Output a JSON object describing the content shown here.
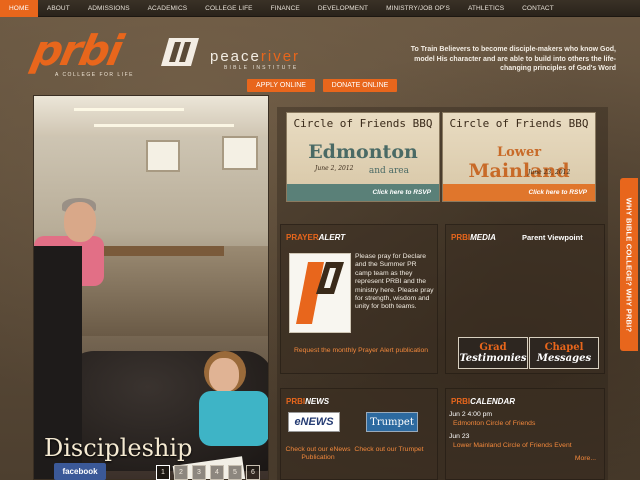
{
  "nav": {
    "items": [
      "HOME",
      "ABOUT",
      "ADMISSIONS",
      "ACADEMICS",
      "COLLEGE LIFE",
      "FINANCE",
      "DEVELOPMENT",
      "MINISTRY/JOB OP'S",
      "ATHLETICS",
      "CONTACT"
    ],
    "active": "HOME"
  },
  "brand": {
    "logo_text": "prbi",
    "tagline": "A COLLEGE FOR LIFE",
    "institute_peace": "peace",
    "institute_river": "river",
    "institute_sub": "BIBLE INSTITUTE",
    "accent_color": "#e8661c"
  },
  "mission": "To Train Believers to become disciple-makers who know God, model His character and are able to build into others the life-changing principles of God's Word",
  "buttons": {
    "apply": "APPLY ONLINE",
    "donate": "DONATE ONLINE"
  },
  "hero": {
    "caption": "Discipleship",
    "facebook": "facebook",
    "pages": [
      "1",
      "2",
      "3",
      "4",
      "5",
      "6"
    ],
    "active_page": "1"
  },
  "events": [
    {
      "title": "Circle of Friends BBQ",
      "place": "Edmonton",
      "place_sub": "and area",
      "date": "June 2, 2012",
      "rsvp": "Click here to RSVP"
    },
    {
      "title": "Circle of Friends BBQ",
      "place_pre": "Lower",
      "place": "Mainland",
      "date": "June 23, 2012",
      "rsvp": "Click here to RSVP"
    }
  ],
  "prayer": {
    "heading_pre": "PRAYER",
    "heading": "ALERT",
    "text": "Please pray for Declare and the Summer PR camp team as they represent PRBI and the ministry here. Please pray for strength, wisdom and unity for both teams.",
    "link": "Request the monthly Prayer Alert publication"
  },
  "media": {
    "heading_pre": "PRBI",
    "heading": "MEDIA",
    "parent_viewpoint": "Parent Viewpoint",
    "grad_l1": "Grad",
    "grad_l2": "Testimonies",
    "chapel_l1": "Chapel",
    "chapel_l2": "Messages"
  },
  "news": {
    "heading_pre": "PRBI",
    "heading": "NEWS",
    "enews_label": "eNEWS",
    "trumpet_label": "Trumpet",
    "enews_caption": "Check out our eNews Publication",
    "trumpet_caption": "Check out our Trumpet"
  },
  "calendar": {
    "heading_pre": "PRBI",
    "heading": "CALENDAR",
    "items": [
      {
        "date": "Jun 2 4:00 pm",
        "title": "Edmonton Circle of Friends"
      },
      {
        "date": "Jun 23",
        "title": "Lower Mainland Circle of Friends Event"
      }
    ],
    "more": "More..."
  },
  "side_tab": "WHY BIBLE COLLEGE?  WHY PRBI?"
}
